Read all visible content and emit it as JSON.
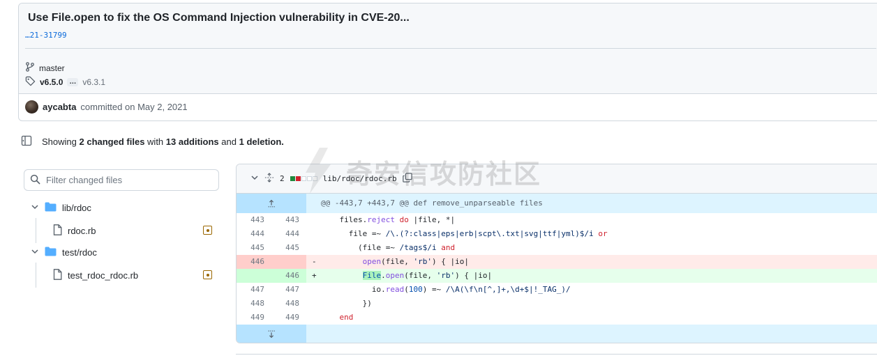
{
  "commit": {
    "title": "Use File.open to fix the OS Command Injection vulnerability in CVE-20...",
    "description_tail": "…21-31799",
    "branch": "master",
    "tags": {
      "first": "v6.5.0",
      "ellipsis": "…",
      "last": "v6.3.1"
    },
    "author": "aycabta",
    "committed_text": "committed on May 2, 2021"
  },
  "summary": {
    "prefix": "Showing",
    "files_count": "2 changed files",
    "with": "with",
    "additions": "13 additions",
    "and": "and",
    "deletions": "1 deletion."
  },
  "file_tree": {
    "filter_placeholder": "Filter changed files",
    "items": [
      {
        "type": "folder",
        "label": "lib/rdoc"
      },
      {
        "type": "file",
        "label": "rdoc.rb",
        "status": "modified"
      },
      {
        "type": "folder",
        "label": "test/rdoc"
      },
      {
        "type": "file",
        "label": "test_rdoc_rdoc.rb",
        "status": "modified"
      }
    ]
  },
  "diff": {
    "changes_count": "2",
    "diffstat": [
      "add",
      "del",
      "neutral",
      "neutral",
      "neutral"
    ],
    "file_path": "lib/rdoc/rdoc.rb",
    "hunk_header": "@@ -443,7 +443,7 @@ def remove_unparseable files",
    "lines": [
      {
        "kind": "ctx",
        "old": "443",
        "new": "443",
        "marker": "",
        "code": "files.reject do |file, *|"
      },
      {
        "kind": "ctx",
        "old": "444",
        "new": "444",
        "marker": "",
        "code": "file =~ /\\.(?:class|eps|erb|scpt\\.txt|svg|ttf|yml)$/i or"
      },
      {
        "kind": "ctx",
        "old": "445",
        "new": "445",
        "marker": "",
        "code": "(file =~ /tags$/i and"
      },
      {
        "kind": "del",
        "old": "446",
        "new": "",
        "marker": "-",
        "code": "open(file, 'rb') { |io|"
      },
      {
        "kind": "add",
        "old": "",
        "new": "446",
        "marker": "+",
        "code": "File.open(file, 'rb') { |io|"
      },
      {
        "kind": "ctx",
        "old": "447",
        "new": "447",
        "marker": "",
        "code": "io.read(100) =~ /\\A(\\f\\n[^,]+,\\d+$|!_TAG_)/"
      },
      {
        "kind": "ctx",
        "old": "448",
        "new": "448",
        "marker": "",
        "code": "})"
      },
      {
        "kind": "ctx",
        "old": "449",
        "new": "449",
        "marker": "",
        "code": "end"
      }
    ]
  },
  "watermark": "奇安信攻防社区",
  "colors": {
    "accent_blue": "#0969da",
    "addition_green": "#1f883d",
    "deletion_red": "#cf222e",
    "hunk_blue": "#ddf4ff",
    "modified_amber": "#9a6700"
  }
}
